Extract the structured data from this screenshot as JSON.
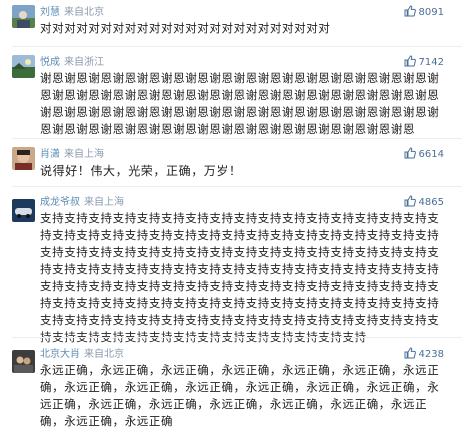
{
  "comments": [
    {
      "name": "刘慧",
      "location": "来自北京",
      "likes": "8091",
      "text": "对对对对对对对对对对对对对对对对对对对对对对对对"
    },
    {
      "name": "悦成",
      "location": "来自浙江",
      "likes": "7142",
      "text": "谢恩谢恩谢恩谢恩谢恩谢恩谢恩谢恩谢恩谢恩谢恩谢恩谢恩谢恩谢恩谢恩谢恩谢恩谢恩谢恩谢恩谢恩谢恩谢恩谢恩谢恩谢恩谢恩谢恩谢恩谢恩谢恩谢恩谢恩谢恩谢恩谢恩谢恩谢恩谢恩谢恩谢恩谢恩谢恩谢恩谢恩谢恩谢恩谢恩谢恩谢恩谢恩谢恩谢恩谢恩谢恩谢恩谢恩谢恩谢恩谢恩谢恩谢恩谢恩谢恩"
    },
    {
      "name": "肖潇",
      "location": "来自上海",
      "likes": "6614",
      "text": "说得好！伟大，光荣，正确，万岁！"
    },
    {
      "name": "成龙爷叔",
      "location": "来自上海",
      "likes": "4865",
      "text": "支持支持支持支持支持支持支持支持支持支持支持支持支持支持支持支持支持支持支持支持支持支持支持支持支持支持支持支持支持支持支持支持支持支持支持支持支持支持支持支持支持支持支持支持支持支持支持支持支持支持支持支持支持支持支持支持支持支持支持支持支持支持支持支持支持支持支持支持支持支持支持支持支持支持支持支持支持支持支持支持支持支持支持支持支持支持支持支持支持支持支持支持支持支持支持支持支持支持支持支持支持支持支持支持支持支持支持支持支持支持支持支持支持支持支持支持支持支持支持支持支持支持支持支持支持支持支持支持支持"
    },
    {
      "name": "北京大肖",
      "location": "来自北京",
      "likes": "4238",
      "text": "永远正确，永远正确，永远正确，永远正确，永远正确，永远正确，永远正确，永远正确，永远正确，永远正确，永远正确，永远正确，永远正确，永远正确，永远正确，永远正确，永远正确，永远正确，永远正确，永远正确，永远正确，永远正确"
    }
  ],
  "colors": {
    "name": "#5d8cb4",
    "location": "#8a9aae",
    "likes": "#4a6f98",
    "text": "#222222"
  },
  "icons": {
    "like": "thumbs-up-icon"
  }
}
